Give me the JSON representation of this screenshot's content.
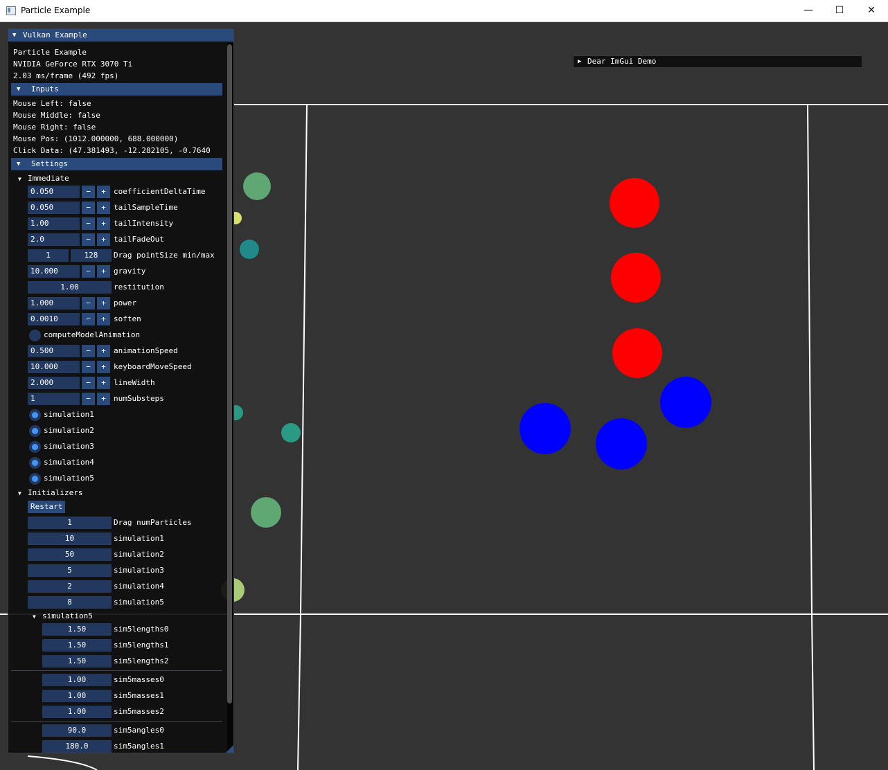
{
  "window": {
    "title": "Particle Example",
    "controls": {
      "minimize": "—",
      "maximize": "☐",
      "close": "✕"
    }
  },
  "demo_window": {
    "title": "Dear ImGui Demo",
    "collapsed": true
  },
  "panel": {
    "title": "Vulkan Example",
    "info": [
      "Particle Example",
      "NVIDIA GeForce RTX 3070 Ti",
      "2.03 ms/frame (492 fps)"
    ],
    "inputs_header": "Inputs",
    "inputs": [
      "Mouse Left: false",
      "Mouse Middle: false",
      "Mouse Right: false",
      "Mouse Pos: (1012.000000, 688.000000)",
      "Click Data: (47.381493, -12.282105, -0.7640"
    ],
    "settings_header": "Settings",
    "immediate_label": "Immediate",
    "immediate": {
      "coefficientDeltaTime": {
        "value": "0.050",
        "label": "coefficientDeltaTime"
      },
      "tailSampleTime": {
        "value": "0.050",
        "label": "tailSampleTime"
      },
      "tailIntensity": {
        "value": "1.00",
        "label": "tailIntensity"
      },
      "tailFadeOut": {
        "value": "2.0",
        "label": "tailFadeOut"
      },
      "pointSize": {
        "min": "1",
        "max": "128",
        "label": "Drag pointSize min/max"
      },
      "gravity": {
        "value": "10.000",
        "label": "gravity"
      },
      "restitution": {
        "value": "1.00",
        "label": "restitution"
      },
      "power": {
        "value": "1.000",
        "label": "power"
      },
      "soften": {
        "value": "0.0010",
        "label": "soften"
      },
      "computeModelAnimation": {
        "label": "computeModelAnimation",
        "checked": false
      },
      "animationSpeed": {
        "value": "0.500",
        "label": "animationSpeed"
      },
      "keyboardMoveSpeed": {
        "value": "10.000",
        "label": "keyboardMoveSpeed"
      },
      "lineWidth": {
        "value": "2.000",
        "label": "lineWidth"
      },
      "numSubsteps": {
        "value": "1",
        "label": "numSubsteps"
      },
      "minus": "−",
      "plus": "+"
    },
    "simulations": [
      "simulation1",
      "simulation2",
      "simulation3",
      "simulation4",
      "simulation5"
    ],
    "initializers_label": "Initializers",
    "restart_label": "Restart",
    "initializers": [
      {
        "value": "1",
        "label": "Drag numParticles"
      },
      {
        "value": "10",
        "label": "simulation1"
      },
      {
        "value": "50",
        "label": "simulation2"
      },
      {
        "value": "5",
        "label": "simulation3"
      },
      {
        "value": "2",
        "label": "simulation4"
      },
      {
        "value": "8",
        "label": "simulation5"
      }
    ],
    "sim5_label": "simulation5",
    "sim5_lengths": [
      {
        "value": "1.50",
        "label": "sim5lengths0"
      },
      {
        "value": "1.50",
        "label": "sim5lengths1"
      },
      {
        "value": "1.50",
        "label": "sim5lengths2"
      }
    ],
    "sim5_masses": [
      {
        "value": "1.00",
        "label": "sim5masses0"
      },
      {
        "value": "1.00",
        "label": "sim5masses1"
      },
      {
        "value": "1.00",
        "label": "sim5masses2"
      }
    ],
    "sim5_angles": [
      {
        "value": "90.0",
        "label": "sim5angles0"
      },
      {
        "value": "180.0",
        "label": "sim5angles1"
      }
    ]
  },
  "colors": {
    "header": "#294a7a",
    "frame": "#22385e",
    "check": "#4296fa",
    "red_particle": "#ff0000",
    "blue_particle": "#0000ff",
    "background": "#333333"
  }
}
